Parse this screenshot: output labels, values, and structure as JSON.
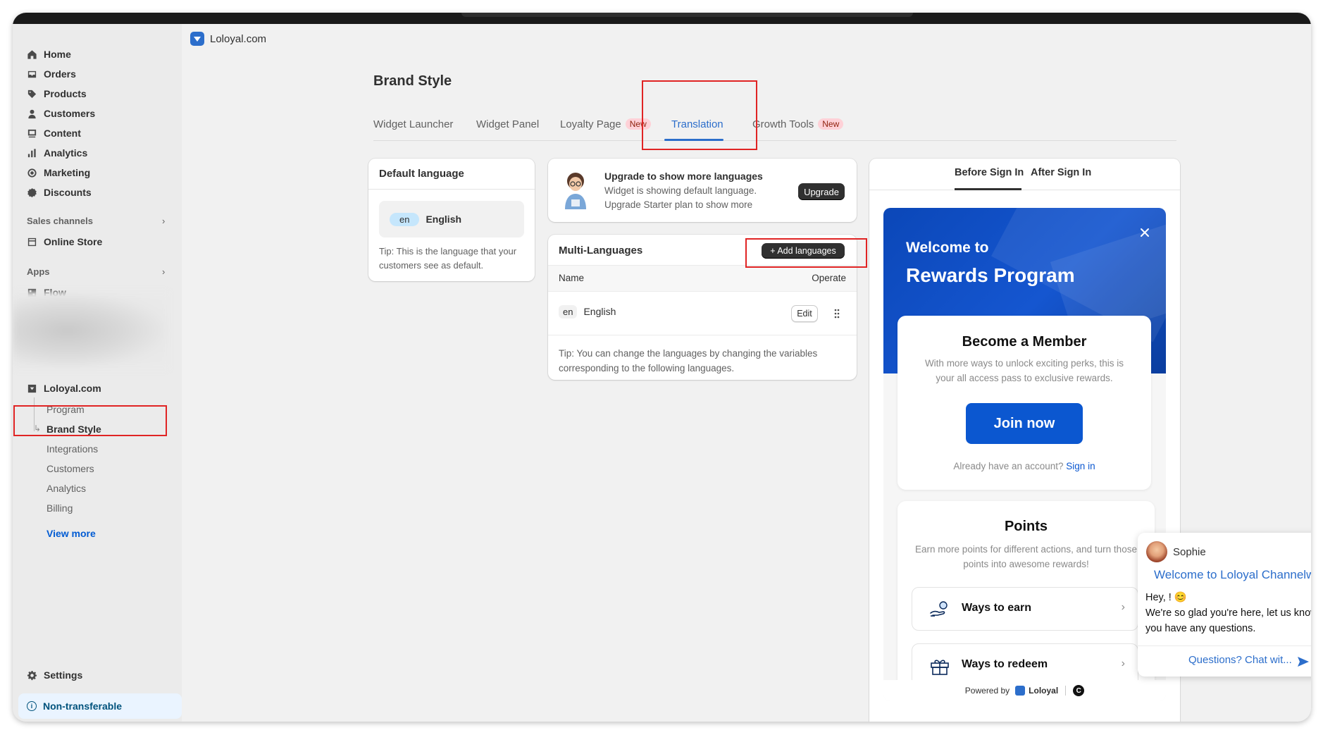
{
  "app": {
    "name": "Loloyal.com"
  },
  "sidebar": {
    "items": [
      {
        "label": "Home",
        "icon": "home-icon"
      },
      {
        "label": "Orders",
        "icon": "inbox-icon"
      },
      {
        "label": "Products",
        "icon": "tag-icon"
      },
      {
        "label": "Customers",
        "icon": "person-icon"
      },
      {
        "label": "Content",
        "icon": "content-icon"
      },
      {
        "label": "Analytics",
        "icon": "bar-chart-icon"
      },
      {
        "label": "Marketing",
        "icon": "target-icon"
      },
      {
        "label": "Discounts",
        "icon": "discount-icon"
      }
    ],
    "sales_channels_title": "Sales channels",
    "online_store": "Online Store",
    "apps_title": "Apps",
    "flow": "Flow",
    "app_name": "Loloyal.com",
    "sub_items": [
      "Program",
      "Brand Style",
      "Integrations",
      "Customers",
      "Analytics",
      "Billing"
    ],
    "view_more": "View more",
    "settings": "Settings",
    "non_transferable": "Non-transferable"
  },
  "page": {
    "title": "Brand Style",
    "tabs": [
      {
        "label": "Widget Launcher"
      },
      {
        "label": "Widget Panel"
      },
      {
        "label": "Loyalty Page",
        "badge": "New"
      },
      {
        "label": "Translation",
        "active": true
      },
      {
        "label": "Growth Tools",
        "badge": "New"
      }
    ]
  },
  "default_language": {
    "title": "Default language",
    "code": "en",
    "name": "English",
    "tip": "Tip: This is the language that your customers see as default."
  },
  "upgrade": {
    "title": "Upgrade to show more languages",
    "line1": "Widget is showing default language.",
    "line2": "Upgrade Starter plan to show more",
    "button": "Upgrade"
  },
  "multi_languages": {
    "title": "Multi-Languages",
    "add_button": "+ Add languages",
    "col_name": "Name",
    "col_operate": "Operate",
    "rows": [
      {
        "code": "en",
        "name": "English",
        "action": "Edit"
      }
    ],
    "tip": "Tip: You can change the languages by changing the variables corresponding to the following languages."
  },
  "preview": {
    "tabs": [
      "Before Sign In",
      "After Sign In"
    ],
    "hero_title1": "Welcome to",
    "hero_title2": "Rewards Program",
    "member_title": "Become a Member",
    "member_desc": "With more ways to unlock exciting perks, this is your all access pass to exclusive rewards.",
    "join_button": "Join now",
    "signin_prefix": "Already have an account?",
    "signin_link": "Sign in",
    "points_title": "Points",
    "points_desc": "Earn more points for different actions, and turn those points into awesome rewards!",
    "ways_to_earn": "Ways to earn",
    "ways_to_redeem": "Ways to redeem",
    "powered_by": "Powered by",
    "powered_brand": "Loloyal"
  },
  "chat": {
    "agent": "Sophie",
    "welcome": "Welcome to Loloyal Channelw",
    "greeting": "Hey, ! 😊",
    "message": "We're so glad you're here, let us know if you have any questions.",
    "cta": "Questions? Chat wit..."
  },
  "colors": {
    "accent": "#2c6ecb",
    "hero_blue": "#0b47b8",
    "join_blue": "#0b57d0",
    "highlight_red": "#e02424"
  }
}
